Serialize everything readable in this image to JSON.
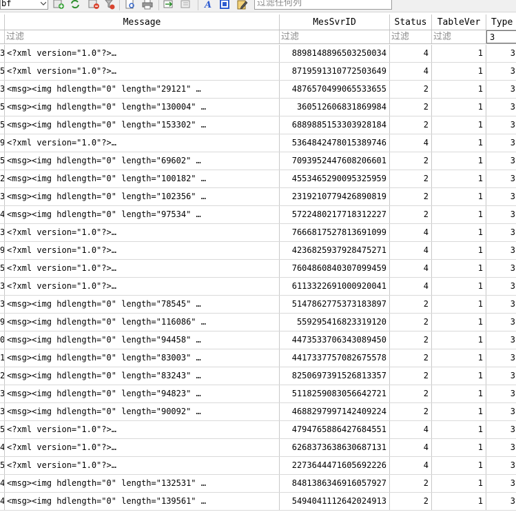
{
  "toolbar": {
    "table_select_value": "bf",
    "search_placeholder": "过滤任何列"
  },
  "columns": {
    "message": "Message",
    "messvrid": "MesSvrID",
    "status": "Status",
    "tablever": "TableVer",
    "type": "Type"
  },
  "filters": {
    "message": "过滤",
    "messvrid": "过滤",
    "status": "过滤",
    "tablever": "过滤",
    "type": "3"
  },
  "rows": [
    {
      "id": "3",
      "message": "<?xml version=\"1.0\"?>…",
      "messvrid": "8898148896503250034",
      "status": "4",
      "tablever": "1",
      "type": "3"
    },
    {
      "id": "5",
      "message": "<?xml version=\"1.0\"?>…",
      "messvrid": "8719591310772503649",
      "status": "4",
      "tablever": "1",
      "type": "3"
    },
    {
      "id": "3",
      "message": "<msg><img hdlength=\"0\" length=\"29121\" …",
      "messvrid": "4876570499065533655",
      "status": "2",
      "tablever": "1",
      "type": "3"
    },
    {
      "id": "5",
      "message": "<msg><img hdlength=\"0\" length=\"130004\" …",
      "messvrid": "360512606831869984",
      "status": "2",
      "tablever": "1",
      "type": "3"
    },
    {
      "id": "5",
      "message": "<msg><img hdlength=\"0\" length=\"153302\" …",
      "messvrid": "6889885153303928184",
      "status": "2",
      "tablever": "1",
      "type": "3"
    },
    {
      "id": "9",
      "message": "<?xml version=\"1.0\"?>…",
      "messvrid": "5364842478015389746",
      "status": "4",
      "tablever": "1",
      "type": "3"
    },
    {
      "id": "5",
      "message": "<msg><img hdlength=\"0\" length=\"69602\" …",
      "messvrid": "7093952447608206601",
      "status": "2",
      "tablever": "1",
      "type": "3"
    },
    {
      "id": "2",
      "message": "<msg><img hdlength=\"0\" length=\"100182\" …",
      "messvrid": "4553465290095325959",
      "status": "2",
      "tablever": "1",
      "type": "3"
    },
    {
      "id": "3",
      "message": "<msg><img hdlength=\"0\" length=\"102356\" …",
      "messvrid": "2319210779426890819",
      "status": "2",
      "tablever": "1",
      "type": "3"
    },
    {
      "id": "4",
      "message": "<msg><img hdlength=\"0\" length=\"97534\" …",
      "messvrid": "5722480217718312227",
      "status": "2",
      "tablever": "1",
      "type": "3"
    },
    {
      "id": "3",
      "message": "<?xml version=\"1.0\"?>…",
      "messvrid": "7666817527813691099",
      "status": "4",
      "tablever": "1",
      "type": "3"
    },
    {
      "id": "9",
      "message": "<?xml version=\"1.0\"?>…",
      "messvrid": "4236825937928475271",
      "status": "4",
      "tablever": "1",
      "type": "3"
    },
    {
      "id": "5",
      "message": "<?xml version=\"1.0\"?>…",
      "messvrid": "7604860840307099459",
      "status": "4",
      "tablever": "1",
      "type": "3"
    },
    {
      "id": "3",
      "message": "<?xml version=\"1.0\"?>…",
      "messvrid": "6113322691000920041",
      "status": "4",
      "tablever": "1",
      "type": "3"
    },
    {
      "id": "3",
      "message": "<msg><img hdlength=\"0\" length=\"78545\" …",
      "messvrid": "5147862775373183897",
      "status": "2",
      "tablever": "1",
      "type": "3"
    },
    {
      "id": "9",
      "message": "<msg><img hdlength=\"0\" length=\"116086\" …",
      "messvrid": "559295416823319120",
      "status": "2",
      "tablever": "1",
      "type": "3"
    },
    {
      "id": "0",
      "message": "<msg><img hdlength=\"0\" length=\"94458\" …",
      "messvrid": "4473533706343089450",
      "status": "2",
      "tablever": "1",
      "type": "3"
    },
    {
      "id": "1",
      "message": "<msg><img hdlength=\"0\" length=\"83003\" …",
      "messvrid": "4417337757082675578",
      "status": "2",
      "tablever": "1",
      "type": "3"
    },
    {
      "id": "2",
      "message": "<msg><img hdlength=\"0\" length=\"83243\" …",
      "messvrid": "8250697391526813357",
      "status": "2",
      "tablever": "1",
      "type": "3"
    },
    {
      "id": "3",
      "message": "<msg><img hdlength=\"0\" length=\"94823\" …",
      "messvrid": "5118259083056642721",
      "status": "2",
      "tablever": "1",
      "type": "3"
    },
    {
      "id": "3",
      "message": "<msg><img hdlength=\"0\" length=\"90092\" …",
      "messvrid": "4688297997142409224",
      "status": "2",
      "tablever": "1",
      "type": "3"
    },
    {
      "id": "5",
      "message": "<?xml version=\"1.0\"?>…",
      "messvrid": "4794765886427684551",
      "status": "4",
      "tablever": "1",
      "type": "3"
    },
    {
      "id": "4",
      "message": "<?xml version=\"1.0\"?>…",
      "messvrid": "6268373638630687131",
      "status": "4",
      "tablever": "1",
      "type": "3"
    },
    {
      "id": "5",
      "message": "<?xml version=\"1.0\"?>…",
      "messvrid": "2273644471605692226",
      "status": "4",
      "tablever": "1",
      "type": "3"
    },
    {
      "id": "4",
      "message": "<msg><img hdlength=\"0\" length=\"132531\" …",
      "messvrid": "8481386346916057927",
      "status": "2",
      "tablever": "1",
      "type": "3"
    },
    {
      "id": "4",
      "message": "<msg><img hdlength=\"0\" length=\"139561\" …",
      "messvrid": "5494041112642024913",
      "status": "2",
      "tablever": "1",
      "type": "3"
    }
  ]
}
